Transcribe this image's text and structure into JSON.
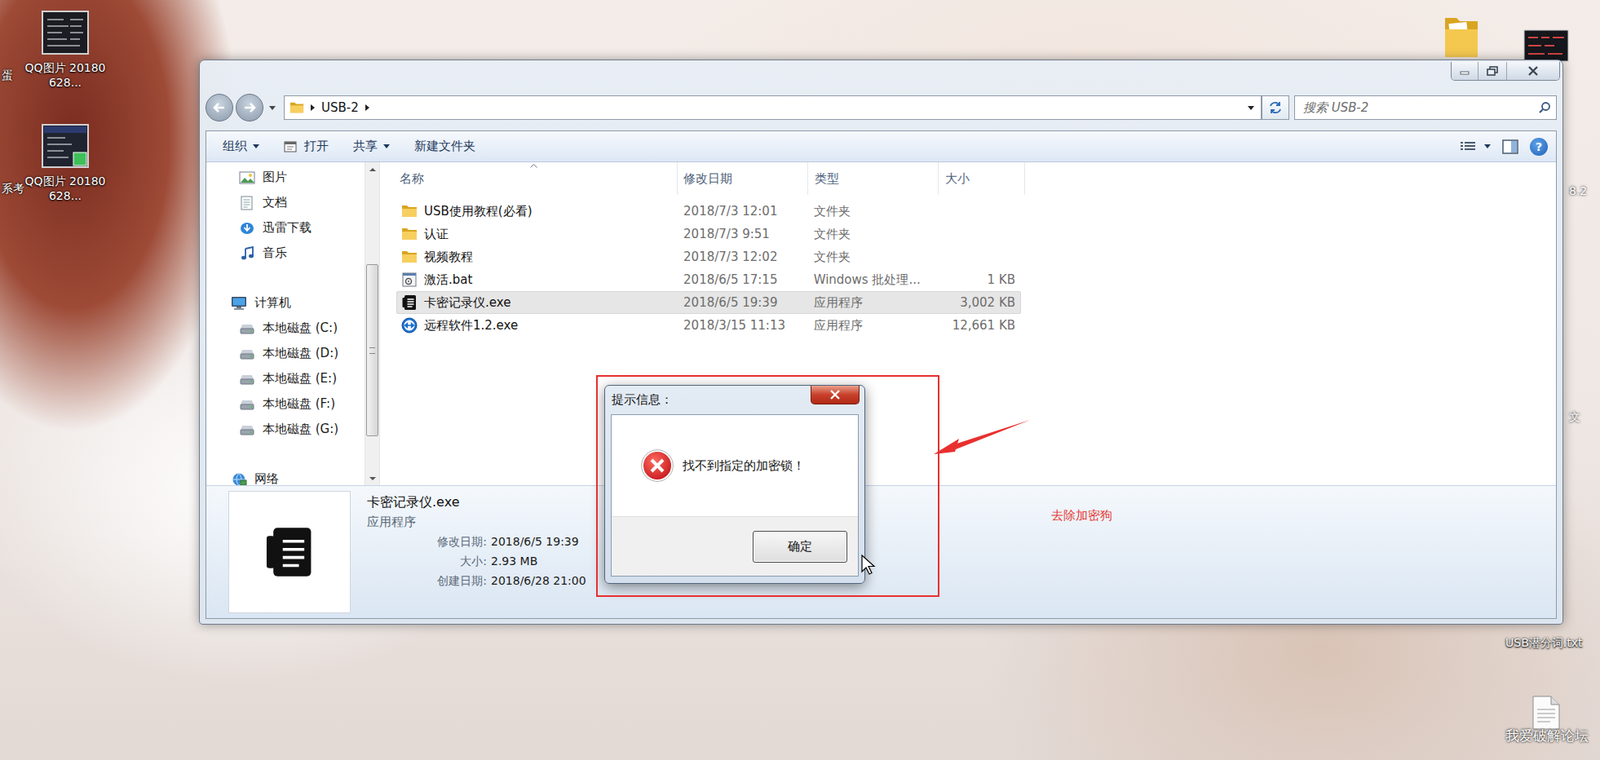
{
  "desktop": {
    "icons": [
      {
        "label": "QQ图片 20180628...",
        "kind": "image"
      },
      {
        "label": "QQ图片 20180628...",
        "kind": "psd"
      }
    ],
    "cut_labels": [
      "蛋",
      "系考"
    ],
    "right_labels": [
      "8.2",
      "文"
    ],
    "file": {
      "label": "USB潜分词.txt"
    },
    "watermark": "我爱破解论坛"
  },
  "explorer": {
    "breadcrumb": [
      "USB-2"
    ],
    "search": {
      "placeholder": "搜索 USB-2"
    },
    "toolbar": [
      {
        "label": "组织",
        "dropdown": true,
        "kind": "menu"
      },
      {
        "label": "打开",
        "dropdown": false,
        "kind": "open"
      },
      {
        "label": "共享",
        "dropdown": true,
        "kind": "menu"
      },
      {
        "label": "新建文件夹",
        "dropdown": false,
        "kind": "menu"
      }
    ],
    "help": "?",
    "nav": [
      {
        "label": "图片",
        "kind": "pictures"
      },
      {
        "label": "文档",
        "kind": "documents"
      },
      {
        "label": "迅雷下载",
        "kind": "downloads"
      },
      {
        "label": "音乐",
        "kind": "music"
      },
      {
        "label": "计算机",
        "kind": "computer"
      },
      {
        "label": "本地磁盘 (C:)",
        "kind": "drive"
      },
      {
        "label": "本地磁盘 (D:)",
        "kind": "drive"
      },
      {
        "label": "本地磁盘 (E:)",
        "kind": "drive"
      },
      {
        "label": "本地磁盘 (F:)",
        "kind": "drive"
      },
      {
        "label": "本地磁盘 (G:)",
        "kind": "drive"
      },
      {
        "label": "网络",
        "kind": "network"
      }
    ],
    "columns": [
      {
        "label": "名称",
        "sorted": true
      },
      {
        "label": "修改日期",
        "sorted": false
      },
      {
        "label": "类型",
        "sorted": false
      },
      {
        "label": "大小",
        "sorted": false
      }
    ],
    "rows": [
      {
        "name": "USB使用教程(必看)",
        "modified": "2018/7/3 12:01",
        "type": "文件夹",
        "size": "",
        "kind": "folder",
        "selected": false
      },
      {
        "name": "认证",
        "modified": "2018/7/3 9:51",
        "type": "文件夹",
        "size": "",
        "kind": "folder",
        "selected": false
      },
      {
        "name": "视频教程",
        "modified": "2018/7/3 12:02",
        "type": "文件夹",
        "size": "",
        "kind": "folder",
        "selected": false
      },
      {
        "name": "激活.bat",
        "modified": "2018/6/5 17:15",
        "type": "Windows 批处理...",
        "size": "1 KB",
        "kind": "bat",
        "selected": false
      },
      {
        "name": "卡密记录仪.exe",
        "modified": "2018/6/5 19:39",
        "type": "应用程序",
        "size": "3,002 KB",
        "kind": "exe",
        "selected": true
      },
      {
        "name": "远程软件1.2.exe",
        "modified": "2018/3/15 11:13",
        "type": "应用程序",
        "size": "12,661 KB",
        "kind": "remote",
        "selected": false
      }
    ],
    "details": {
      "name": "卡密记录仪.exe",
      "type": "应用程序",
      "fields": [
        {
          "label": "修改日期:",
          "value": "2018/6/5 19:39"
        },
        {
          "label": "大小:",
          "value": "2.93 MB"
        },
        {
          "label": "创建日期:",
          "value": "2018/6/28 21:00"
        }
      ]
    }
  },
  "dialog": {
    "title": "提示信息：",
    "message": "找不到指定的加密锁！",
    "button": "确定"
  },
  "annotation": {
    "text": "去除加密狗"
  }
}
